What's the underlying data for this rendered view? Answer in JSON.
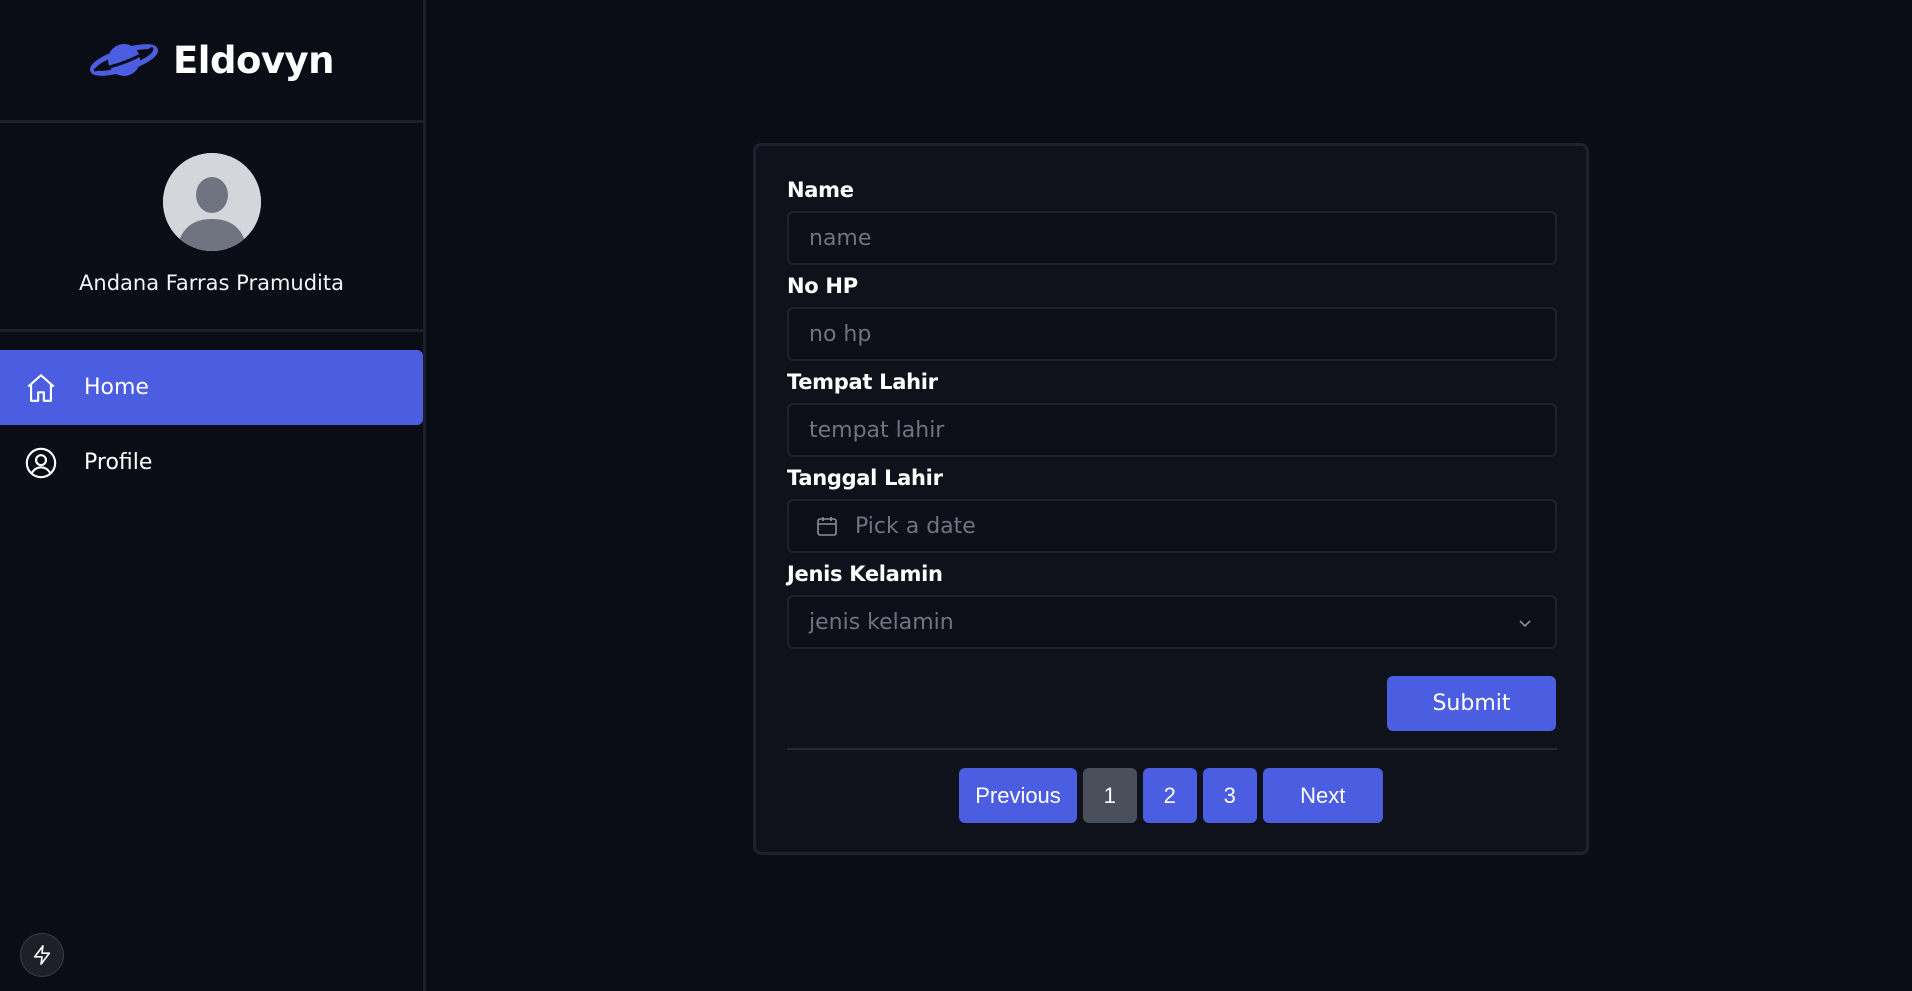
{
  "app": {
    "name": "Eldovyn"
  },
  "user": {
    "name": "Andana Farras Pramudita"
  },
  "sidebar": {
    "items": [
      {
        "label": "Home",
        "icon": "home-icon",
        "active": true
      },
      {
        "label": "Profile",
        "icon": "user-circle-icon",
        "active": false
      }
    ]
  },
  "form": {
    "name": {
      "label": "Name",
      "placeholder": "name"
    },
    "phone": {
      "label": "No HP",
      "placeholder": "no hp"
    },
    "birthplace": {
      "label": "Tempat Lahir",
      "placeholder": "tempat lahir"
    },
    "birthdate": {
      "label": "Tanggal Lahir",
      "placeholder": "Pick a date"
    },
    "gender": {
      "label": "Jenis Kelamin",
      "placeholder": "jenis kelamin"
    },
    "submit_label": "Submit"
  },
  "pagination": {
    "previous": "Previous",
    "pages": [
      "1",
      "2",
      "3"
    ],
    "current": "1",
    "next": "Next"
  },
  "colors": {
    "accent": "#4b5de0",
    "background": "#0a0c16",
    "card": "#0f111b"
  }
}
